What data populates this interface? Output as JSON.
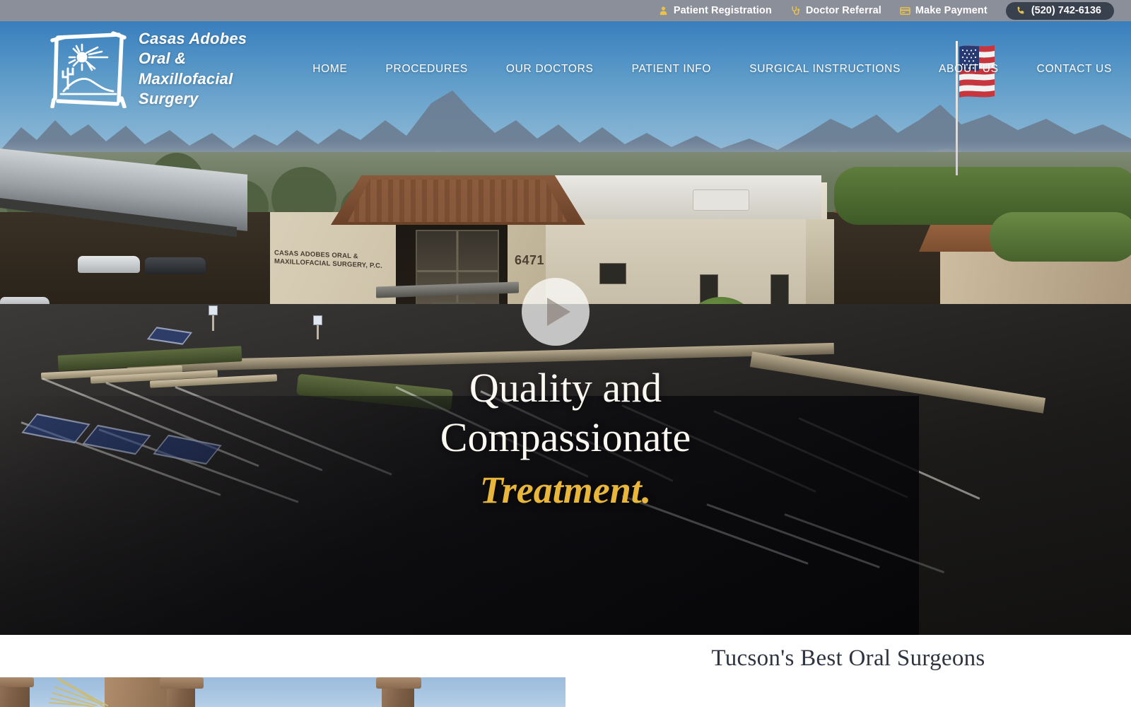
{
  "topbar": {
    "links": [
      {
        "label": "Patient Registration",
        "icon": "person-icon"
      },
      {
        "label": "Doctor Referral",
        "icon": "stethoscope-icon"
      },
      {
        "label": "Make Payment",
        "icon": "credit-card-icon"
      }
    ],
    "phone": {
      "label": "(520) 742-6136",
      "icon": "phone-icon"
    },
    "background_color": "#8b8f9a",
    "icon_color": "#e8c24a",
    "phone_pill_color": "#39414f"
  },
  "header": {
    "logo": {
      "name": "Casas Adobes Oral &\nMaxillofacial Surgery",
      "icon": "desert-sun-cactus-logo-icon"
    },
    "nav": [
      {
        "label": "HOME"
      },
      {
        "label": "PROCEDURES"
      },
      {
        "label": "OUR DOCTORS"
      },
      {
        "label": "PATIENT INFO"
      },
      {
        "label": "SURGICAL INSTRUCTIONS"
      },
      {
        "label": "ABOUT US"
      },
      {
        "label": "CONTACT US"
      }
    ]
  },
  "hero": {
    "play_button": "play-icon",
    "headline_line1": "Quality and",
    "headline_line2": "Compassionate",
    "headline_accent": "Treatment.",
    "accent_color": "#e8b63a",
    "building_sign": "CASAS ADOBES\nORAL & MAXILLOFACIAL\nSURGERY, P.C.",
    "building_address_number": "6471",
    "flag": "american-flag-icon"
  },
  "below_fold": {
    "section_title": "Tucson's Best Oral Surgeons",
    "photo": "building-columns-photo"
  }
}
